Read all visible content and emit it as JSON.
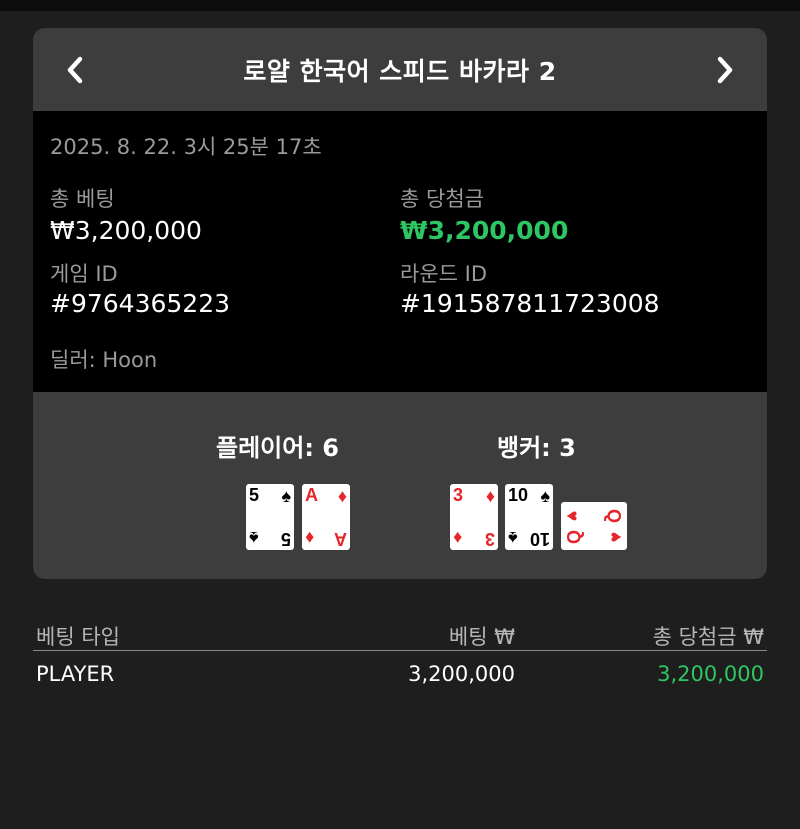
{
  "header": {
    "title": "로얄 한국어 스피드 바카라 2",
    "prev_icon": "chevron-left-icon",
    "next_icon": "chevron-right-icon"
  },
  "info": {
    "datetime": "2025. 8. 22. 3시 25분 17초",
    "total_bet_label": "총 베팅",
    "total_bet_value": "₩3,200,000",
    "total_win_label": "총 당첨금",
    "total_win_value": "₩3,200,000",
    "game_id_label": "게임 ID",
    "game_id_value": "#9764365223",
    "round_id_label": "라운드 ID",
    "round_id_value": "#191587811723008",
    "dealer": "딜러: Hoon"
  },
  "hands": {
    "player_label": "플레이어: 6",
    "banker_label": "뱅커: 3",
    "player_cards": [
      {
        "rank": "5",
        "suit": "♠",
        "color": "black"
      },
      {
        "rank": "A",
        "suit": "♦",
        "color": "red"
      }
    ],
    "banker_cards": [
      {
        "rank": "3",
        "suit": "♦",
        "color": "red"
      },
      {
        "rank": "10",
        "suit": "♠",
        "color": "black"
      },
      {
        "rank": "Q",
        "suit": "♥",
        "color": "red"
      }
    ]
  },
  "results": {
    "headers": [
      "베팅 타입",
      "베팅 ₩",
      "총 당첨금 ₩"
    ],
    "rows": [
      {
        "type": "PLAYER",
        "bet": "3,200,000",
        "win": "3,200,000"
      }
    ]
  },
  "colors": {
    "background": "#1e1e1e",
    "panel": "#3d3d3d",
    "info_bg": "#000000",
    "win_green": "#2ec662",
    "card_red": "#e5242b"
  }
}
